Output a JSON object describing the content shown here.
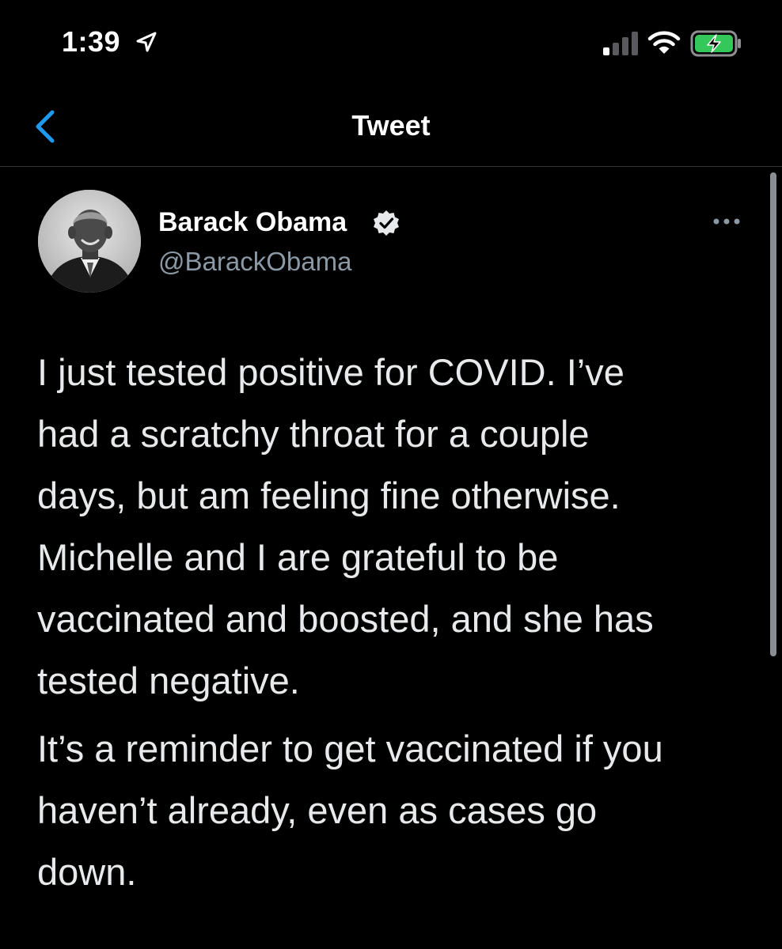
{
  "status_bar": {
    "time": "1:39",
    "icons": [
      "location-arrow-icon",
      "cellular-signal-icon",
      "wifi-icon",
      "battery-charging-icon"
    ]
  },
  "header": {
    "title": "Tweet",
    "back_icon": "chevron-left-icon"
  },
  "tweet": {
    "author": {
      "name": "Barack Obama",
      "handle": "@BarackObama",
      "verified": true,
      "avatar": "profile-photo"
    },
    "more_icon": "ellipsis-icon",
    "paragraphs": [
      [
        "I just tested positive for COVID. I’ve",
        "had a scratchy throat for a couple",
        "days, but am feeling fine otherwise.",
        "Michelle and I are grateful to be",
        "vaccinated and boosted, and she has",
        "tested negative."
      ],
      [
        "It’s a reminder to get vaccinated if you",
        "haven’t already, even as cases go",
        "down."
      ]
    ]
  },
  "colors": {
    "background": "#000000",
    "accent": "#1d9bf0",
    "text_primary": "#e7e9ea",
    "text_secondary": "#8b98a5",
    "battery_green": "#34c759"
  }
}
